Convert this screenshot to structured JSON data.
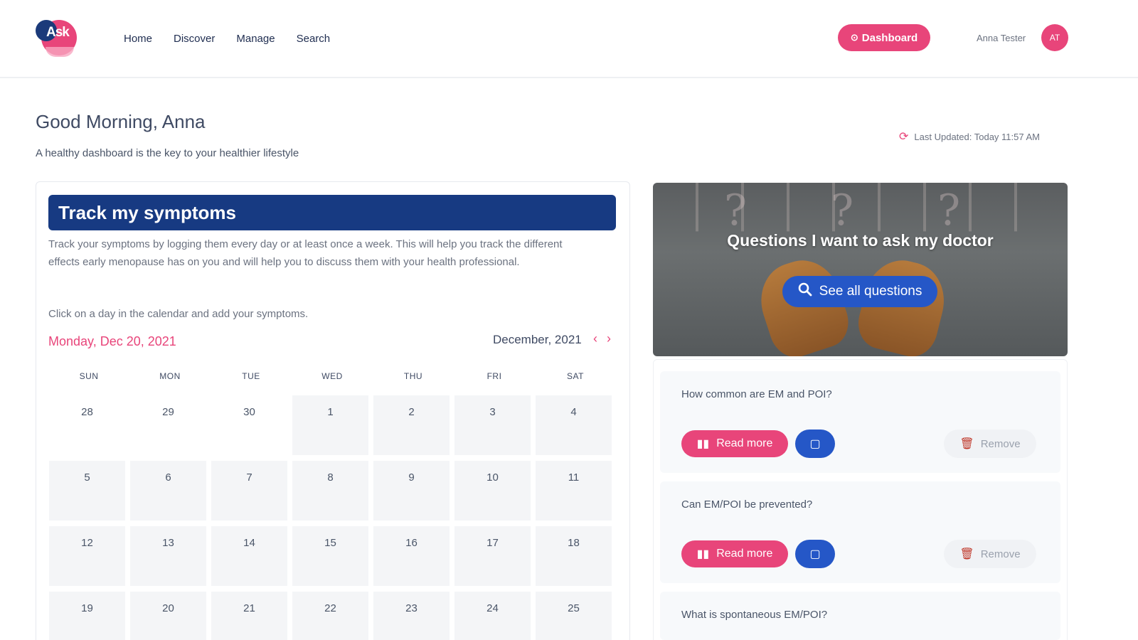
{
  "brand": {
    "logo_text": "Ask"
  },
  "nav": {
    "links": [
      "Home",
      "Discover",
      "Manage",
      "Search"
    ]
  },
  "header": {
    "dashboard_label": "Dashboard",
    "user_name": "Anna Tester",
    "user_initials": "AT"
  },
  "greeting": {
    "title": "Good Morning, Anna",
    "subtitle": "A healthy dashboard is the key to your healthier lifestyle",
    "last_updated": "Last Updated: Today 11:57 AM"
  },
  "symptoms": {
    "title": "Track my symptoms",
    "description": "Track your symptoms by logging them every day or at least once a week. This will help you track the different effects early menopause has on you and will help you to discuss them with your health professional.",
    "hint": "Click on a day in the calendar and add your symptoms.",
    "selected_date": "Monday, Dec 20, 2021",
    "month_label": "December, 2021",
    "weekdays": [
      "SUN",
      "MON",
      "TUE",
      "WED",
      "THU",
      "FRI",
      "SAT"
    ],
    "weeks": [
      [
        "28",
        "29",
        "30",
        "1",
        "2",
        "3",
        "4"
      ],
      [
        "5",
        "6",
        "7",
        "8",
        "9",
        "10",
        "11"
      ],
      [
        "12",
        "13",
        "14",
        "15",
        "16",
        "17",
        "18"
      ],
      [
        "19",
        "20",
        "21",
        "22",
        "23",
        "24",
        "25"
      ]
    ]
  },
  "questions": {
    "hero_title": "Questions I want to ask my doctor",
    "see_all_label": "See all questions",
    "read_more_label": "Read more",
    "remove_label": "Remove",
    "items": [
      "How common are EM and POI?",
      "Can EM/POI be prevented?",
      "What is spontaneous EM/POI?"
    ]
  },
  "colors": {
    "accent": "#e8457a",
    "navy": "#173a82",
    "blue": "#2557c7"
  }
}
